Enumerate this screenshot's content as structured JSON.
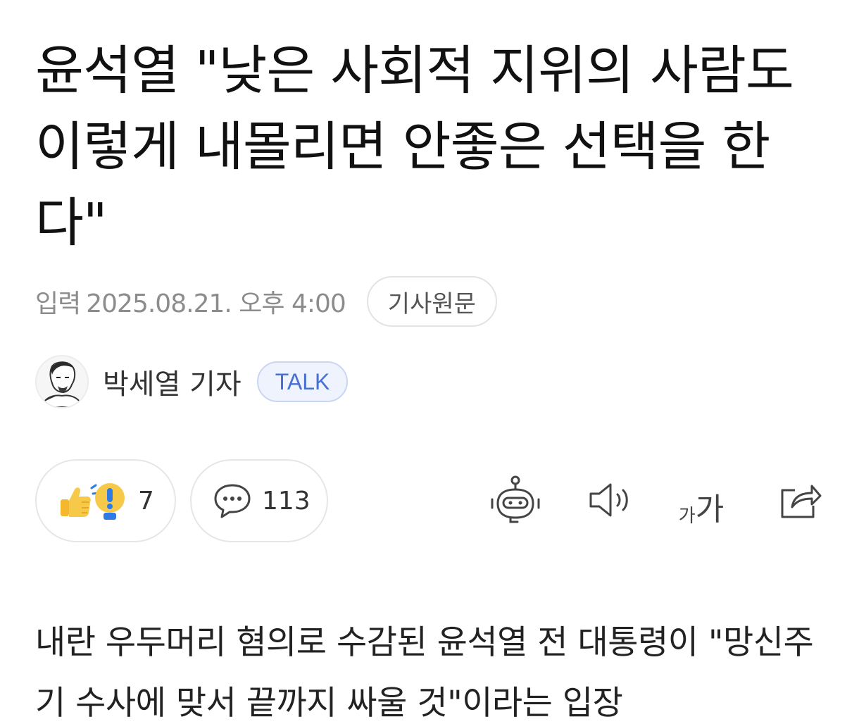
{
  "article": {
    "headline": "윤석열 \"낮은 사회적 지위의 사람도 이렇게 내몰리면 안좋은 선택을 한다\"",
    "date_label": "입력",
    "date_value": "2025.08.21. 오후 4:00",
    "original_link_label": "기사원문",
    "author_name": "박세열 기자",
    "talk_label": "TALK",
    "body_text": "내란 우두머리 혐의로 수감된 윤석열 전 대통령이 \"망신주기 수사에 맞서 끝까지 싸울 것\"이라는 입장"
  },
  "actions": {
    "reaction_count": "7",
    "comment_count": "113",
    "font_size_small": "가",
    "font_size_large": "가"
  },
  "icons": {
    "reaction": "thumbs-up-exclaim-icon",
    "comment": "speech-bubble-icon",
    "summary_bot": "robot-icon",
    "audio": "speaker-icon",
    "font_size": "font-size-icon",
    "share": "share-icon"
  },
  "colors": {
    "talk_accent": "#4a6fd3",
    "reaction_yellow": "#f7c948",
    "reaction_blue": "#2e7be6",
    "meta_gray": "#8c8c8c"
  }
}
